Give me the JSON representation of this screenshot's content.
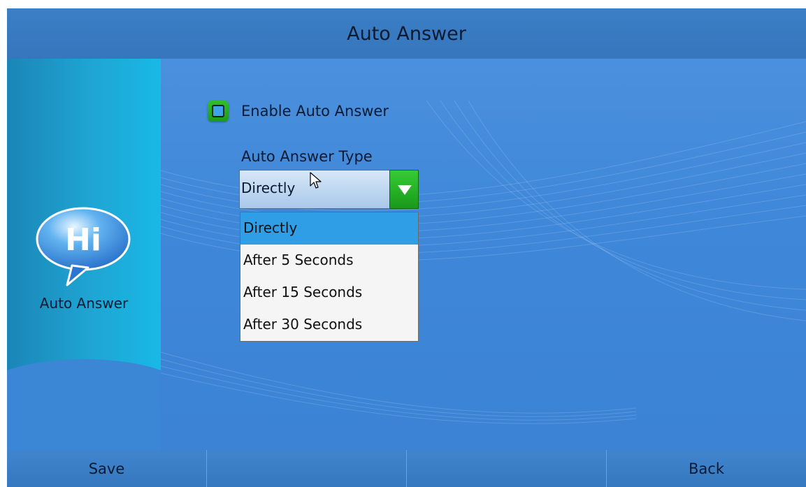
{
  "title": "Auto Answer",
  "sidebar": {
    "icon_text": "Hi",
    "label": "Auto Answer"
  },
  "form": {
    "enable_label": "Enable Auto Answer",
    "enable_checked": false,
    "type_label": "Auto Answer Type",
    "selected_value": "Directly",
    "options": [
      "Directly",
      "After 5 Seconds",
      "After 15 Seconds",
      "After 30 Seconds"
    ]
  },
  "softkeys": [
    "Save",
    "",
    "",
    "Back"
  ],
  "colors": {
    "accent_green": "#2fbf2f",
    "selection_blue": "#2f9ee6",
    "background_blue": "#3f87d9"
  }
}
